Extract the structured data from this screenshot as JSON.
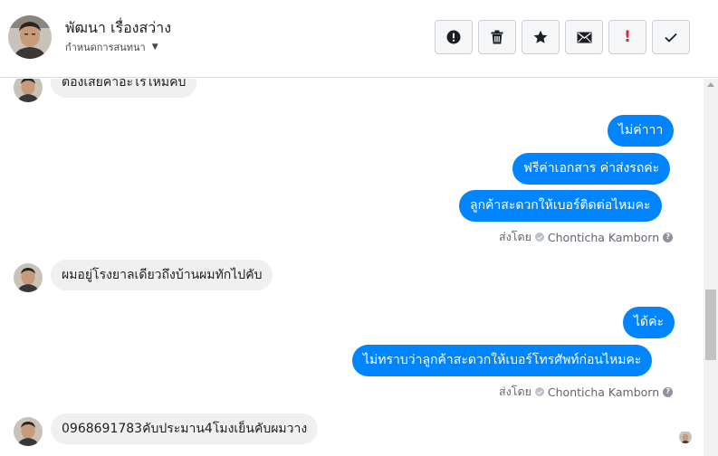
{
  "header": {
    "contact_name": "พัฒนา เรื่องสว่าง",
    "assign_label": "กำหนดการสนทนา",
    "actions": [
      {
        "name": "spam",
        "icon": "exclamation-circle-icon"
      },
      {
        "name": "delete",
        "icon": "trash-icon"
      },
      {
        "name": "star",
        "icon": "star-icon"
      },
      {
        "name": "mark-unread",
        "icon": "envelope-icon"
      },
      {
        "name": "follow-up",
        "icon": "exclamation-icon",
        "color": "#e41e3f"
      },
      {
        "name": "mark-done",
        "icon": "check-icon"
      }
    ]
  },
  "messages": {
    "m1": "ต้องเสียค่าอะไรไหมคับ",
    "m2": "ไม่ค่าาา",
    "m3": "ฟรีค่าเอกสาร ค่าส่งรถค่ะ",
    "m4": "ลูกค้าสะดวกให้เบอร์ติดต่อไหมคะ",
    "m5": "ผมอยู่โรงยาลเดียวถึงบ้านผมทักไปคับ",
    "m6": "ได้ค่ะ",
    "m7": "ไม่ทราบว่าลูกค้าสะดวกให้เบอร์โทรศัพท์ก่อนไหมคะ",
    "m8": "0968691783คับประมาน4โมงเย็นคับผมวาง"
  },
  "sent_by": {
    "label": "ส่งโดย",
    "agent": "Chonticha Kamborn"
  },
  "colors": {
    "outgoing_bubble": "#0084ff",
    "incoming_bubble": "#f1f0f0",
    "alert": "#e41e3f"
  }
}
